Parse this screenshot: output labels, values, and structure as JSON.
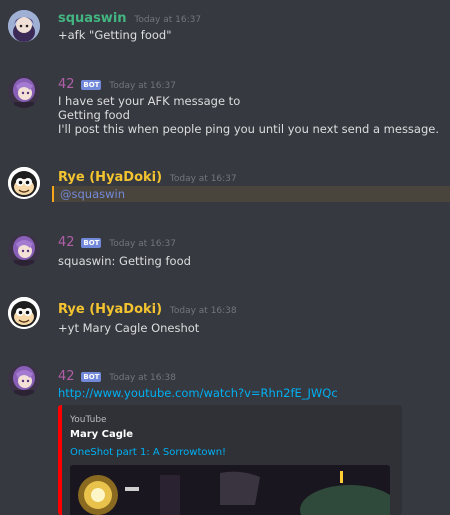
{
  "messages": [
    {
      "username": "squaswin",
      "name_color": "#43b581",
      "bot": false,
      "timestamp": "Today at 16:37",
      "lines": [
        "+afk \"Getting food\""
      ],
      "avatar_icon": "purple-hooded-character-avatar"
    },
    {
      "username": "42",
      "name_color": "#b05ea7",
      "bot": true,
      "bot_label": "BOT",
      "timestamp": "Today at 16:37",
      "lines": [
        "I have set your AFK message to",
        "Getting food",
        "I'll post this when people ping you until you next send a message."
      ],
      "avatar_icon": "purple-haired-character-avatar"
    },
    {
      "username": "Rye (HyaDoki)",
      "name_color": "#f4c430",
      "bot": false,
      "timestamp": "Today at 16:37",
      "mention": "@squaswin",
      "avatar_icon": "cartoon-monkey-avatar"
    },
    {
      "username": "42",
      "name_color": "#b05ea7",
      "bot": true,
      "bot_label": "BOT",
      "timestamp": "Today at 16:37",
      "lines": [
        "squaswin: Getting food"
      ],
      "avatar_icon": "purple-haired-character-avatar"
    },
    {
      "username": "Rye (HyaDoki)",
      "name_color": "#f4c430",
      "bot": false,
      "timestamp": "Today at 16:38",
      "lines": [
        "+yt Mary Cagle Oneshot"
      ],
      "avatar_icon": "cartoon-monkey-avatar"
    },
    {
      "username": "42",
      "name_color": "#b05ea7",
      "bot": true,
      "bot_label": "BOT",
      "timestamp": "Today at 16:38",
      "link": "http://www.youtube.com/watch?v=Rhn2fE_JWQc",
      "avatar_icon": "purple-haired-character-avatar"
    }
  ],
  "embed": {
    "provider": "YouTube",
    "author": "Mary Cagle",
    "title": "OneShot part 1: A Sorrowtown!",
    "accent_color": "#ff0000",
    "thumbnail_icon": "video-thumbnail"
  }
}
